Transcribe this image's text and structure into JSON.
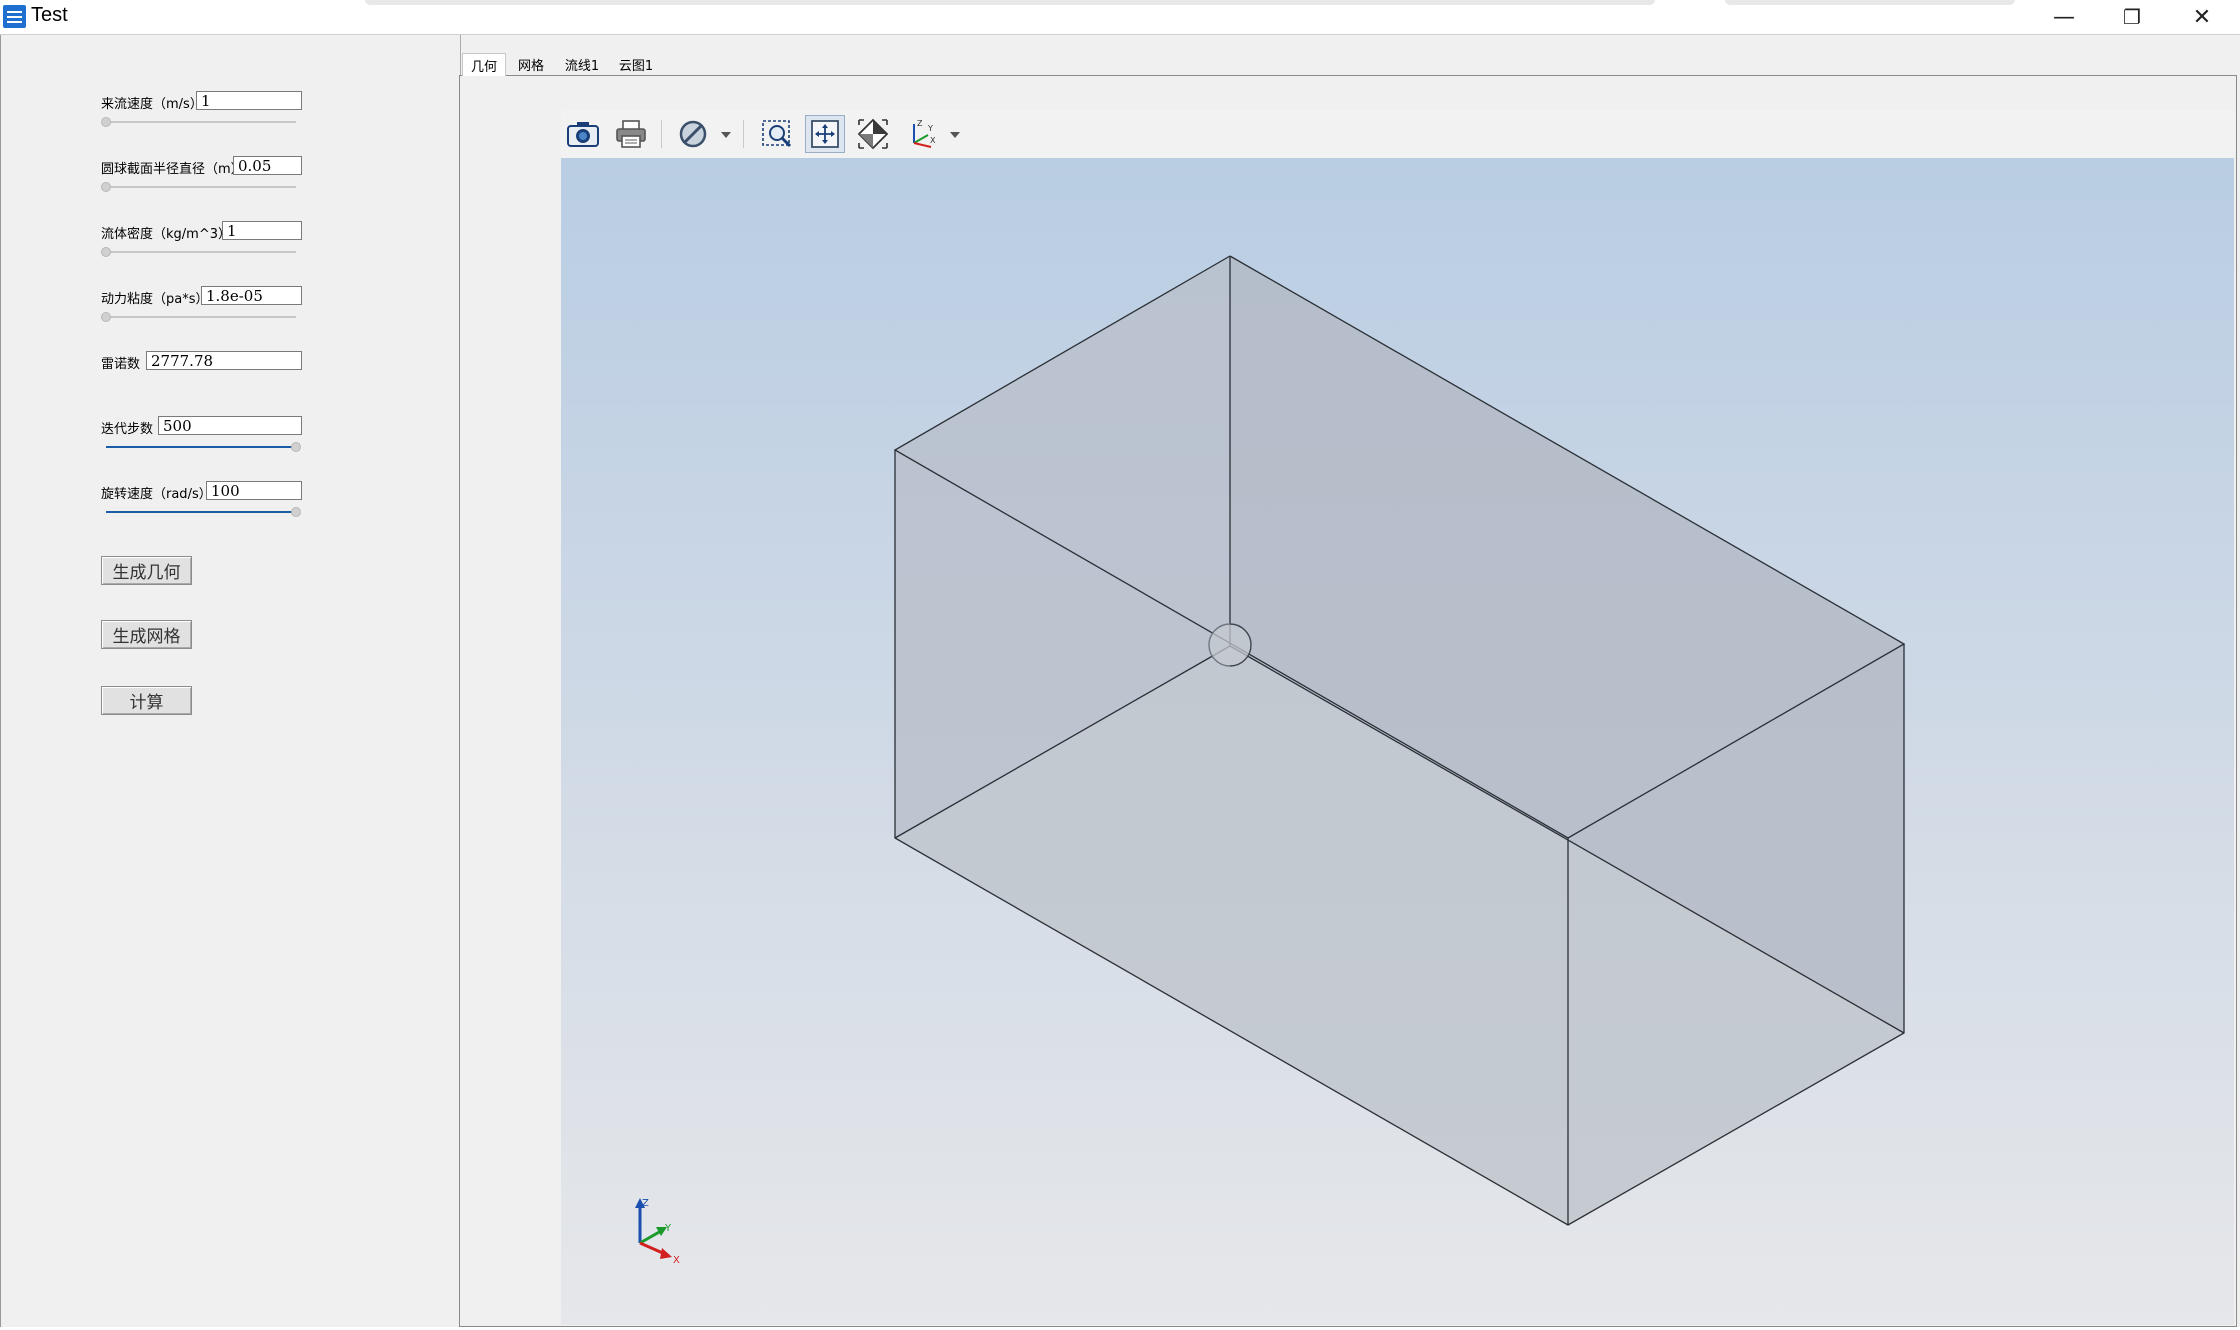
{
  "window": {
    "title": "Test",
    "minimize_glyph": "—",
    "maximize_glyph": "❐",
    "close_glyph": "✕"
  },
  "params": [
    {
      "label": "来流速度（m/s）",
      "value": "1",
      "slider_fraction": 0.0
    },
    {
      "label": "圆球截面半径直径（m）",
      "value": "0.05",
      "slider_fraction": 0.0
    },
    {
      "label": "流体密度（kg/m^3）",
      "value": "1",
      "slider_fraction": 0.0
    },
    {
      "label": "动力粘度（pa*s）",
      "value": "1.8e-05",
      "slider_fraction": 0.0
    },
    {
      "label": "雷诺数",
      "value": "2777.78"
    },
    {
      "label": "迭代步数",
      "value": "500",
      "slider_fraction": 1.0
    },
    {
      "label": "旋转速度（rad/s）",
      "value": "100",
      "slider_fraction": 1.0
    }
  ],
  "buttons": {
    "generate_geometry": "生成几何",
    "generate_mesh": "生成网格",
    "compute": "计算"
  },
  "tabs": [
    {
      "label": "几何",
      "active": true
    },
    {
      "label": "网格",
      "active": false
    },
    {
      "label": "流线1",
      "active": false
    },
    {
      "label": "云图1",
      "active": false
    }
  ],
  "toolbar_icons": [
    "camera-icon",
    "printer-icon",
    "clip-plane-icon",
    "zoom-box-icon",
    "fit-view-icon",
    "reset-view-icon",
    "axes-orientation-icon"
  ],
  "axes_triad": {
    "x": "X",
    "y": "Y",
    "z": "Z"
  },
  "colors": {
    "accent": "#1b5ea7",
    "viewport_top": "#b9cde3",
    "viewport_bottom": "#e6e7ea",
    "box_face": "#b4bcc6"
  }
}
